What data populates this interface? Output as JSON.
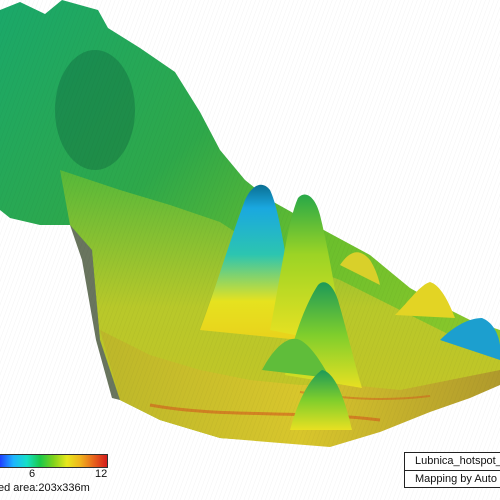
{
  "scene": {
    "colormap": [
      "#1f3fff",
      "#1fb4ff",
      "#16e0c8",
      "#1ac94a",
      "#7fd21c",
      "#e8e81c",
      "#f0b41c",
      "#e8641c",
      "#d41c1c"
    ]
  },
  "legend": {
    "ticks": [
      "6",
      "12"
    ],
    "mapped_area": "ed area:203x336m"
  },
  "info": {
    "name": "Lubnica_hotspot_h",
    "credit": "Mapping by Auto"
  }
}
